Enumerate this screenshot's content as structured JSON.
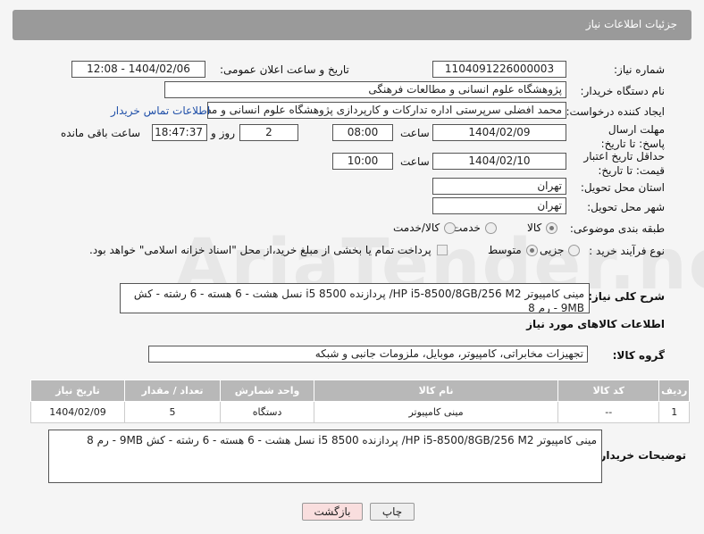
{
  "header": {
    "title": "جزئیات اطلاعات نیاز"
  },
  "need_number": {
    "label": "شماره نیاز:",
    "value": "1104091226000003"
  },
  "announce": {
    "label": "تاریخ و ساعت اعلان عمومی:",
    "value": "1404/02/06 - 12:08"
  },
  "buyer": {
    "label": "نام دستگاه خریدار:",
    "value": "پژوهشگاه علوم انسانی و مطالعات فرهنگی"
  },
  "creator": {
    "label": "ایجاد کننده درخواست:",
    "value": "محمد افضلی سرپرستی اداره تدارکات و کارپردازی پژوهشگاه علوم انسانی و مط",
    "contact_link": "اطلاعات تماس خریدار"
  },
  "deadline": {
    "label": "مهلت ارسال پاسخ: تا تاریخ:",
    "date": "1404/02/09",
    "time_label": "ساعت",
    "time": "08:00",
    "days": "2",
    "days_label": "روز و",
    "remaining": "18:47:37",
    "remaining_label": "ساعت باقی مانده"
  },
  "validity": {
    "label": "حداقل تاریخ اعتبار قیمت: تا تاریخ:",
    "date": "1404/02/10",
    "time_label": "ساعت",
    "time": "10:00"
  },
  "province": {
    "label": "استان محل تحویل:",
    "value": "تهران"
  },
  "city": {
    "label": "شهر محل تحویل:",
    "value": "تهران"
  },
  "category": {
    "label": "طبقه بندی موضوعی:",
    "options": [
      "کالا",
      "خدمت",
      "کالا/خدمت"
    ]
  },
  "process": {
    "label": "نوع فرآیند خرید :",
    "options": [
      "جزیی",
      "متوسط"
    ],
    "note": "پرداخت تمام یا بخشی از مبلغ خرید،از محل \"اسناد خزانه اسلامی\" خواهد بود."
  },
  "description": {
    "label": "شرح کلی نیاز:",
    "value": "مینی کامپیوتر HP i5-8500/8GB/256 M2/ پردازنده i5 8500 نسل هشت - 6 هسته - 6 رشته - کش 9MB - رم 8"
  },
  "goods_section": {
    "title": "اطلاعات کالاهای مورد نیاز"
  },
  "goods_group": {
    "label": "گروه کالا:",
    "value": "تجهیزات مخابراتی، کامپیوتر، موبایل، ملزومات جانبی و شبکه"
  },
  "table": {
    "headers": [
      "ردیف",
      "کد کالا",
      "نام کالا",
      "واحد شمارش",
      "تعداد / مقدار",
      "تاریخ نیاز"
    ],
    "rows": [
      [
        "1",
        "--",
        "مینی کامپیوتر",
        "دستگاه",
        "5",
        "1404/02/09"
      ]
    ]
  },
  "buyer_notes": {
    "label": "توضیحات خریدار:",
    "value": "مینی کامپیوتر HP i5-8500/8GB/256 M2/ پردازنده i5 8500 نسل هشت - 6 هسته - 6 رشته - کش 9MB - رم 8"
  },
  "buttons": {
    "print": "چاپ",
    "back": "بازگشت"
  }
}
